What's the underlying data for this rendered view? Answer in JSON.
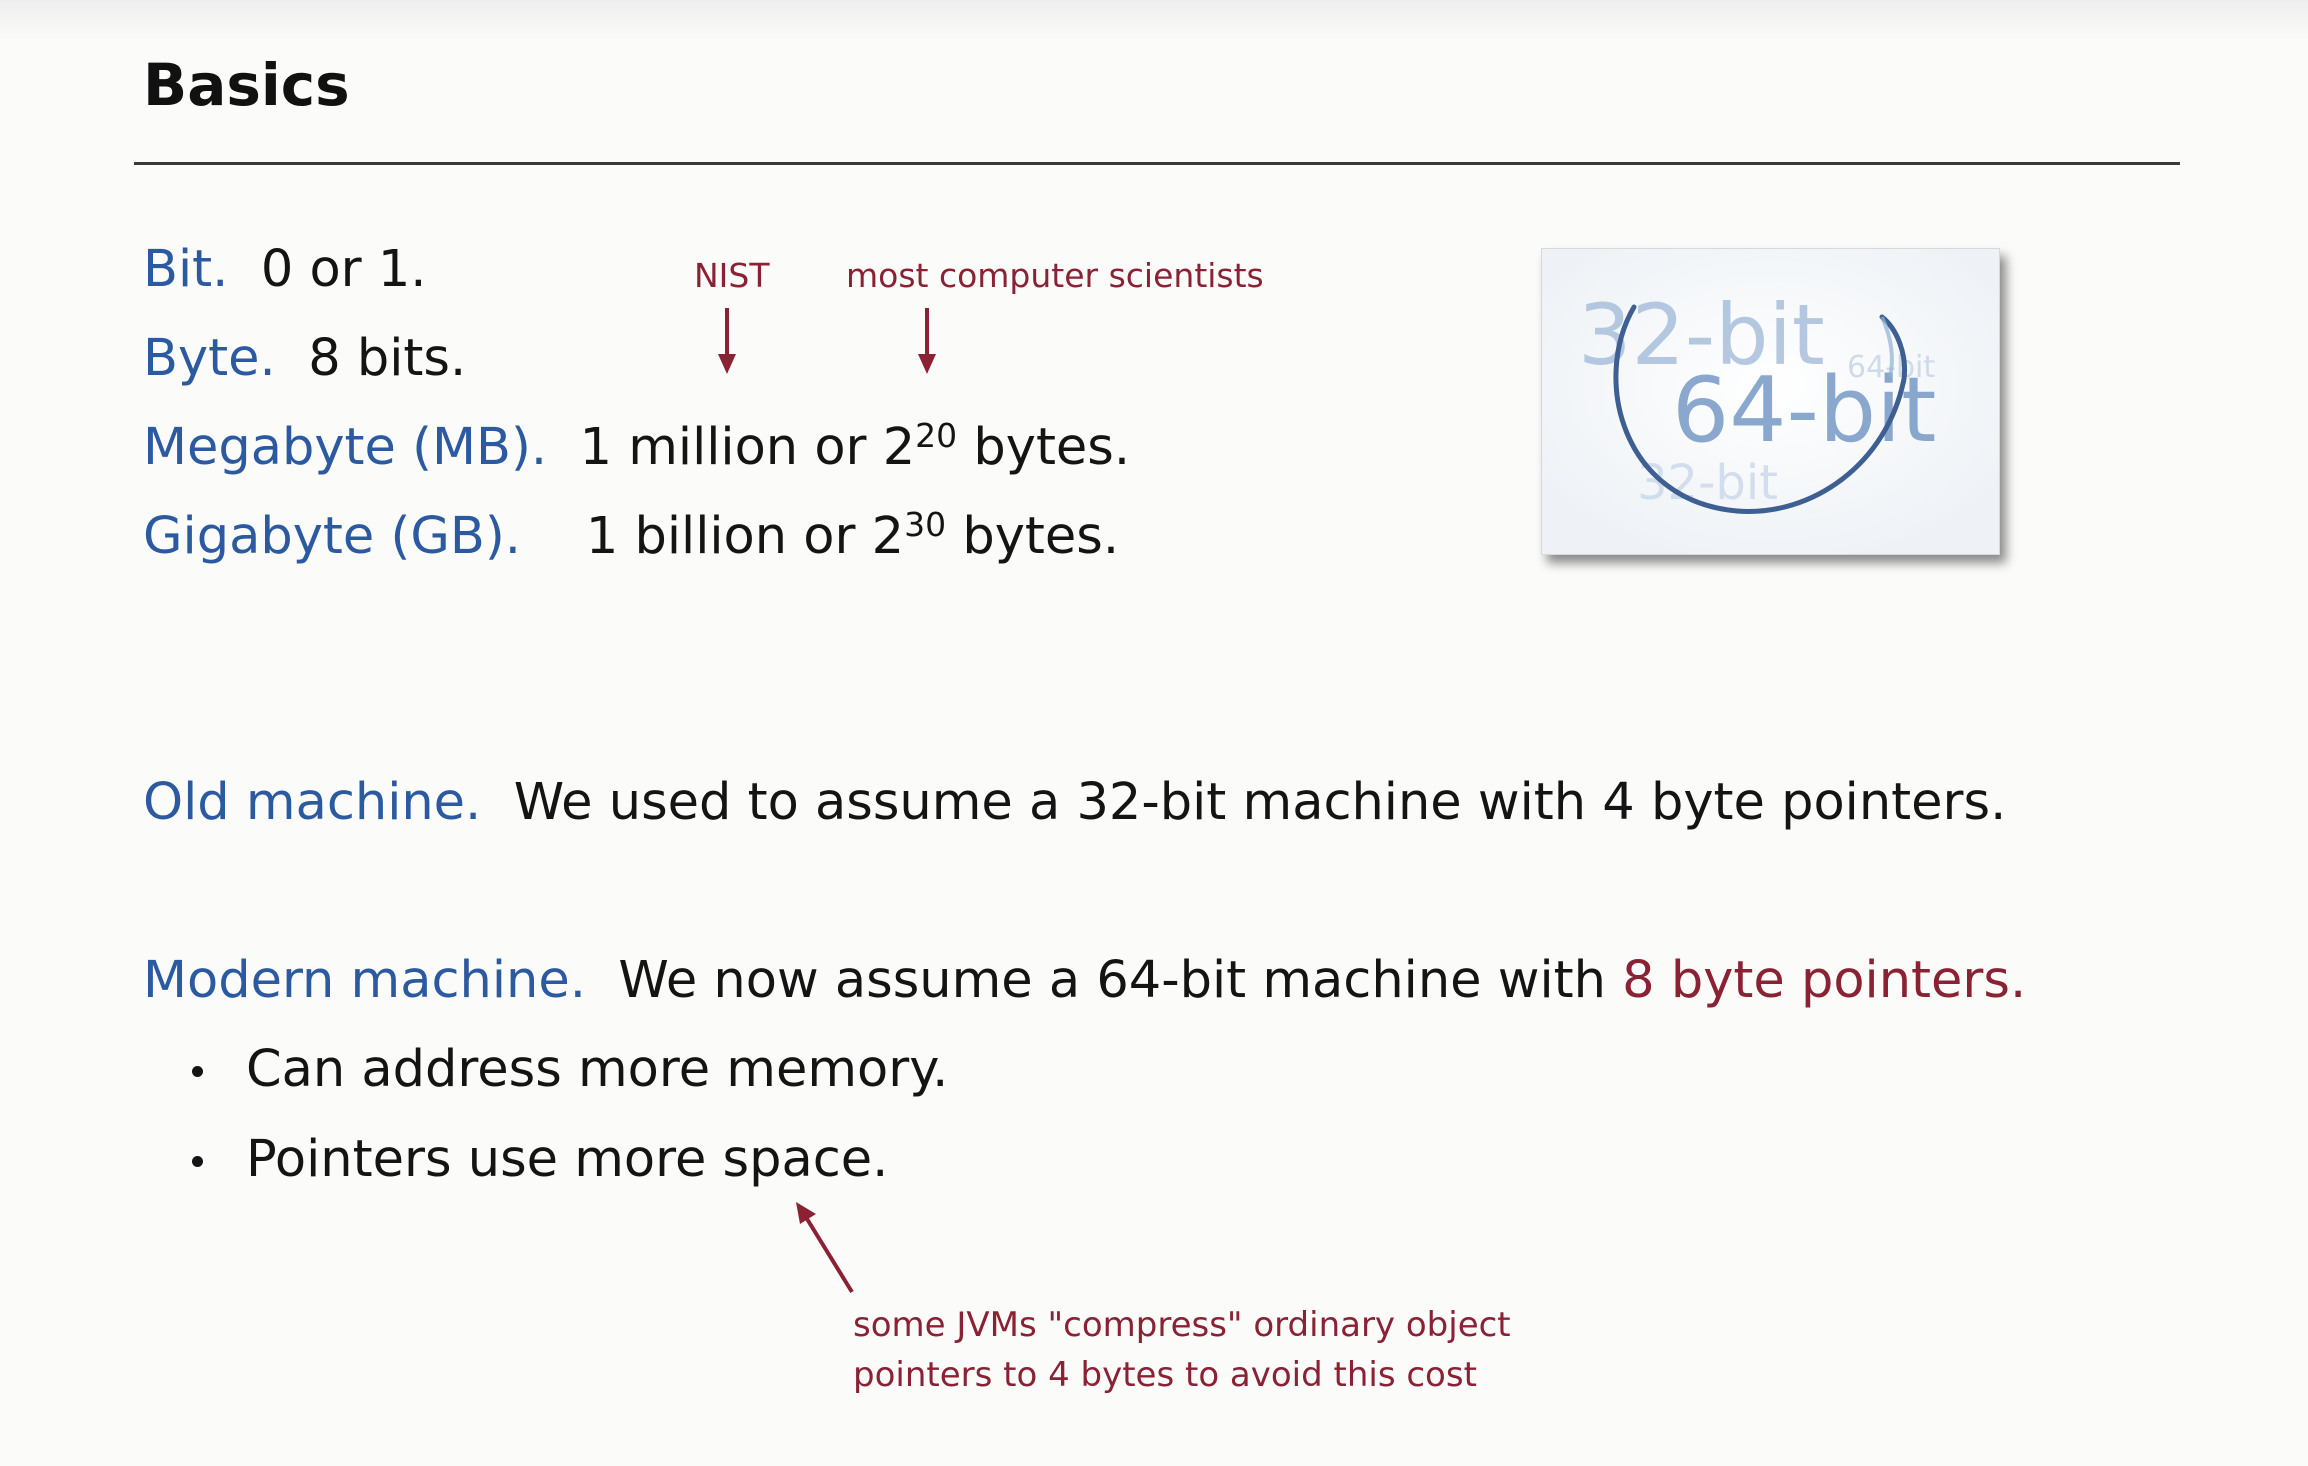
{
  "slide": {
    "title": "Basics",
    "definitions": [
      {
        "term": "Bit.",
        "text": "0 or 1."
      },
      {
        "term": "Byte.",
        "text": "8 bits."
      },
      {
        "term": "Megabyte (MB).",
        "text_before": "1 million or 2",
        "exponent": "20",
        "text_after": " bytes."
      },
      {
        "term": "Gigabyte (GB).",
        "text_before": "1 billion or 2",
        "exponent": "30",
        "text_after": " bytes."
      }
    ],
    "annotations": {
      "nist": "NIST",
      "most_cs": "most computer scientists",
      "jvm_line1": "some JVMs \"compress\" ordinary object",
      "jvm_line2": "pointers to 4 bytes to avoid this cost"
    },
    "figure": {
      "label_32": "32-bit",
      "label_64": "64-bit",
      "small_64": "64-bit",
      "small_32": "32-bit"
    },
    "old_machine": {
      "term": "Old machine.",
      "text": "We used to assume a 32-bit machine with 4 byte pointers."
    },
    "modern_machine": {
      "term": "Modern machine.",
      "text": "We now assume a 64-bit machine with",
      "highlight": "8 byte pointers",
      "end": "."
    },
    "bullets": [
      "Can address more memory.",
      "Pointers use more space."
    ]
  },
  "colors": {
    "term_blue": "#2b5aa0",
    "accent_red": "#8a2234",
    "text": "#141414"
  }
}
